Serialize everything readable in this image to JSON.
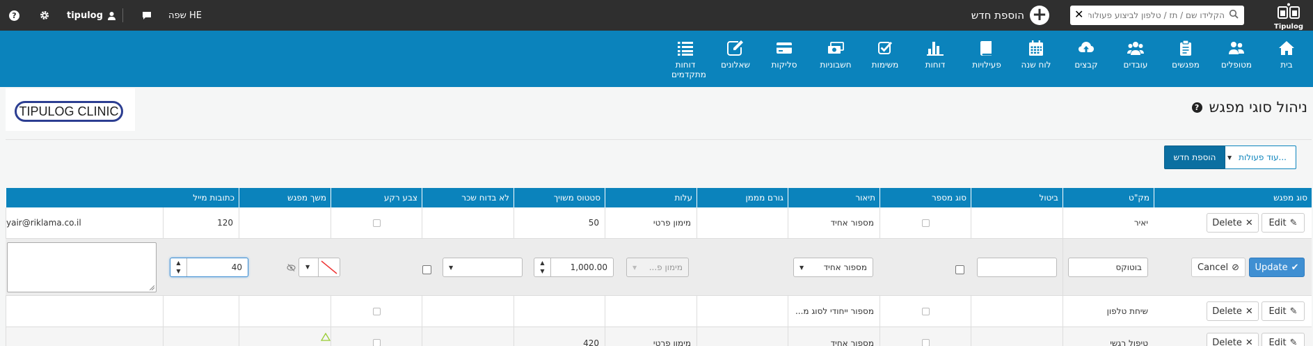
{
  "topbar": {
    "logo_name": "Tipulog",
    "search_placeholder": "הקלידו שם / תז / טלפון לביצוע פעולות",
    "add_new_label": "הוספת חדש",
    "language_label": "שפה HE",
    "username": "tipulog"
  },
  "nav": [
    {
      "label": "בית",
      "icon": "home-icon"
    },
    {
      "label": "מטופלים",
      "icon": "patients-icon"
    },
    {
      "label": "מפגשים",
      "icon": "clipboard-icon"
    },
    {
      "label": "עובדים",
      "icon": "employees-icon"
    },
    {
      "label": "קבצים",
      "icon": "cloud-upload-icon"
    },
    {
      "label": "לוח שנה",
      "icon": "calendar-icon"
    },
    {
      "label": "פעילויות",
      "icon": "book-icon"
    },
    {
      "label": "דוחות",
      "icon": "bar-chart-icon"
    },
    {
      "label": "משימות",
      "icon": "tasks-icon"
    },
    {
      "label": "חשבוניות",
      "icon": "money-icon"
    },
    {
      "label": "סליקות",
      "icon": "credit-card-icon"
    },
    {
      "label": "שאלונים",
      "icon": "edit-icon"
    },
    {
      "label": "דוחות מתקדמים",
      "icon": "list-icon"
    }
  ],
  "page": {
    "title": "ניהול סוגי מפגש",
    "clinic_logo_text": "TIPULOG CLINIC",
    "more_actions_label": "עוד פעולות...",
    "add_new_label": "הוספת חדש"
  },
  "grid": {
    "columns": [
      "סוג מפגש",
      "מק\"ט",
      "ביטול",
      "סוג מספר",
      "תיאור",
      "גורם מממן",
      "עלות",
      "סטטוס משויך",
      "לא בדוח שכר",
      "צבע רקע",
      "משך מפגש",
      "כתובות מייל"
    ],
    "edit_label": "Edit",
    "delete_label": "Delete",
    "update_label": "Update",
    "cancel_label": "Cancel",
    "rows": [
      {
        "type": "יאיר",
        "number_type": "מספור אחיד",
        "funder": "מימון פרטי",
        "cost": "50",
        "duration": "120",
        "email": "yair@riklama.co.il"
      },
      {
        "type": "בוטוקס",
        "number_type": "מספור אחיד",
        "funder": "מימון פ...",
        "cost": "1,000.00",
        "duration": "40"
      },
      {
        "type": "שיחת טלפון",
        "number_type": "מספור ייחודי לסוג מ..."
      },
      {
        "type": "טיפול רגשי",
        "number_type": "מספור אחיד",
        "funder": "מימון פרטי",
        "cost": "420"
      }
    ]
  }
}
